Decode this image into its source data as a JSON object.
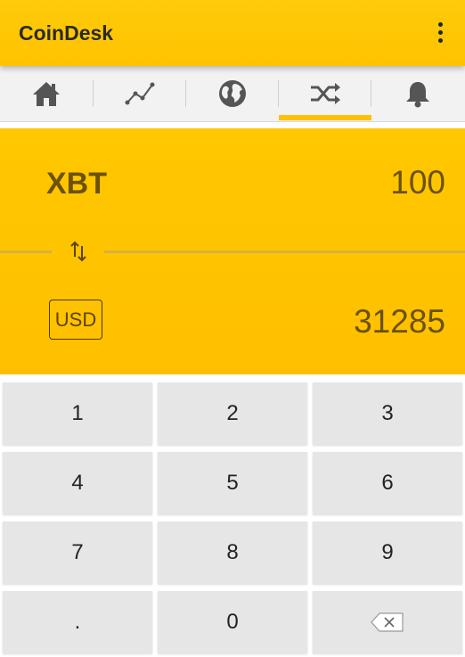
{
  "appbar": {
    "title": "CoinDesk"
  },
  "tabs": [
    {
      "icon": "home-icon"
    },
    {
      "icon": "chart-line-icon"
    },
    {
      "icon": "globe-icon"
    },
    {
      "icon": "shuffle-icon",
      "active": true
    },
    {
      "icon": "bell-icon"
    }
  ],
  "converter": {
    "from_currency": "XBT",
    "from_amount": "100",
    "to_currency": "USD",
    "to_amount": "31285"
  },
  "keypad": {
    "keys": [
      "1",
      "2",
      "3",
      "4",
      "5",
      "6",
      "7",
      "8",
      "9",
      ".",
      "0"
    ],
    "backspace_icon": "backspace-icon"
  },
  "colors": {
    "accent": "#ffc200",
    "text_dark": "#6b5100",
    "key_bg": "#e6e6e6"
  }
}
